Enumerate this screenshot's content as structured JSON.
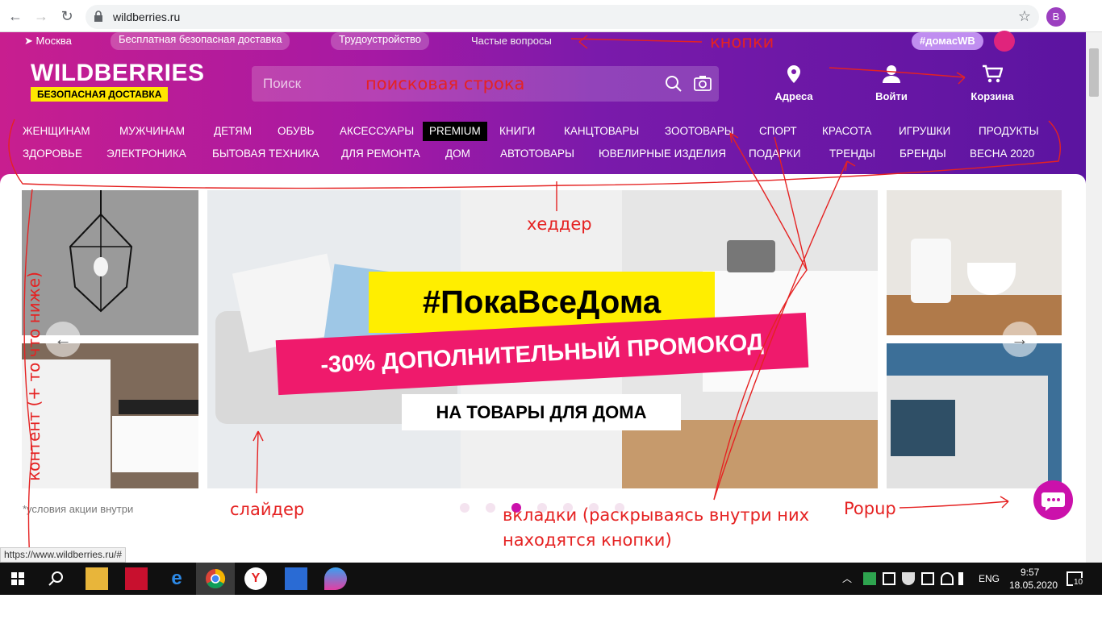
{
  "browser": {
    "url": "wildberries.ru",
    "status_url": "https://www.wildberries.ru/#",
    "profile_initial": "B"
  },
  "header": {
    "topbar": {
      "location": "Москва",
      "free_delivery": "Бесплатная безопасная доставка",
      "jobs": "Трудоустройство",
      "faq": "Частые вопросы",
      "hashtag": "#домасWB"
    },
    "logo": {
      "name": "WILDBERRIES",
      "tagline": "БЕЗОПАСНАЯ ДОСТАВКА"
    },
    "search": {
      "placeholder": "Поиск"
    },
    "actions": {
      "addresses": "Адреса",
      "login": "Войти",
      "cart": "Корзина"
    },
    "categories_row1": [
      "ЖЕНЩИНАМ",
      "МУЖЧИНАМ",
      "ДЕТЯМ",
      "ОБУВЬ",
      "АКСЕССУАРЫ",
      "PREMIUM",
      "КНИГИ",
      "КАНЦТОВАРЫ",
      "ЗООТОВАРЫ",
      "СПОРТ",
      "КРАСОТА",
      "ИГРУШКИ",
      "ПРОДУКТЫ"
    ],
    "categories_row2": [
      "ЗДОРОВЬЕ",
      "ЭЛЕКТРОНИКА",
      "БЫТОВАЯ ТЕХНИКА",
      "ДЛЯ РЕМОНТА",
      "ДОМ",
      "АВТОТОВАРЫ",
      "ЮВЕЛИРНЫЕ ИЗДЕЛИЯ",
      "ПОДАРКИ",
      "ТРЕНДЫ",
      "БРЕНДЫ",
      "ВЕСНА 2020"
    ]
  },
  "banner": {
    "headline": "#ПокаВсеДома",
    "promo": "-30% ДОПОЛНИТЕЛЬНЫЙ ПРОМОКОД",
    "subline": "НА ТОВАРЫ ДЛЯ ДОМА",
    "fine_print": "*условия акции внутри",
    "dots_total": 7,
    "active_dot": 2
  },
  "annotations": {
    "buttons": "кнопки",
    "search": "поисковая строка",
    "header": "хеддер",
    "content": "контент (+ то что ниже)",
    "slider": "слайдер",
    "tabs_line1": "вкладки (раскрываясь внутри них",
    "tabs_line2": "находятся кнопки)",
    "popup": "Popup"
  },
  "taskbar": {
    "lang": "ENG",
    "time": "9:57",
    "date": "18.05.2020",
    "notifications": "10"
  },
  "colors": {
    "brand_magenta": "#cb11ab",
    "brand_purple": "#5b14a0",
    "annotation_red": "#e52222",
    "promo_yellow": "#ffee00",
    "promo_pink": "#ef1a6c"
  }
}
